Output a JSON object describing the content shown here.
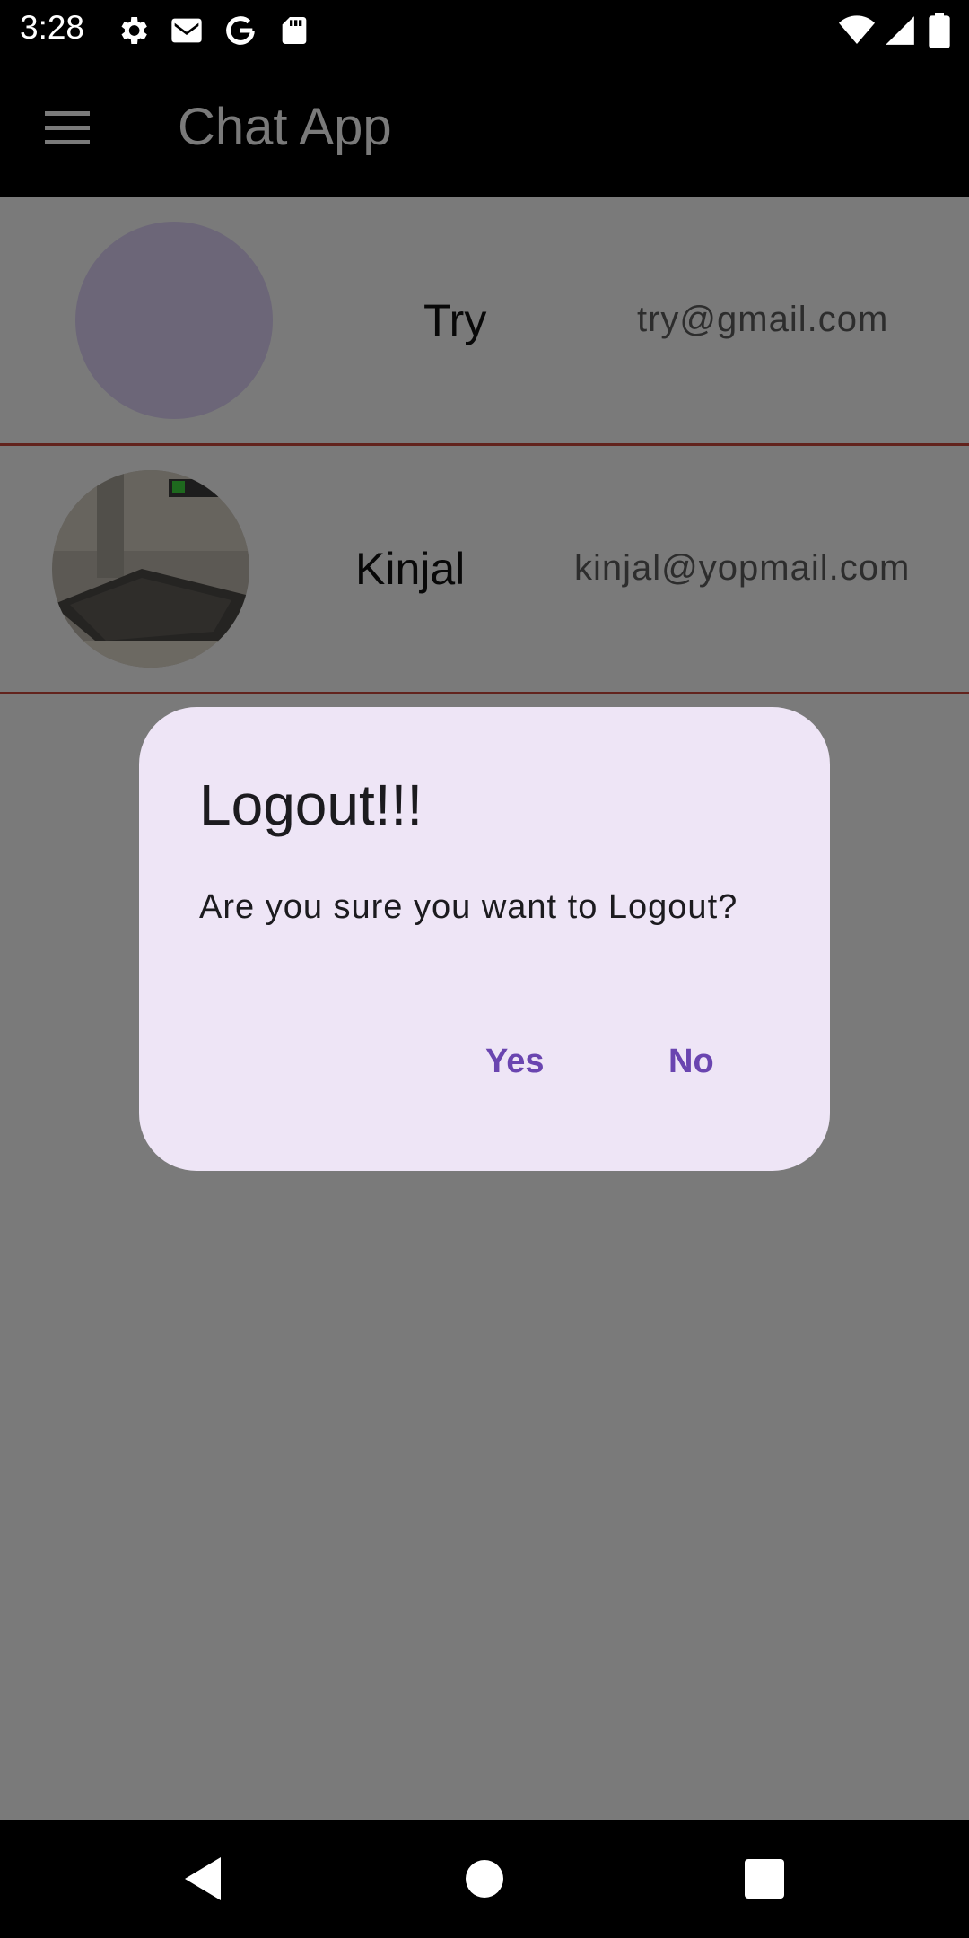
{
  "status_bar": {
    "time": "3:28",
    "icons": [
      "settings-icon",
      "gmail-icon",
      "google-icon",
      "sd-card-icon",
      "wifi-icon",
      "signal-icon",
      "battery-icon"
    ]
  },
  "app_bar": {
    "title": "Chat App",
    "menu_icon": "menu-icon"
  },
  "users": [
    {
      "name": "Try",
      "email": "try@gmail.com",
      "avatar": "placeholder-lavender"
    },
    {
      "name": "Kinjal",
      "email": "kinjal@yopmail.com",
      "avatar": "room-photo"
    }
  ],
  "dialog": {
    "title": "Logout!!!",
    "message": "Are you sure you want to Logout?",
    "yes_label": "Yes",
    "no_label": "No"
  },
  "nav_bar": {
    "icons": [
      "back-icon",
      "home-icon",
      "recents-icon"
    ]
  },
  "colors": {
    "accent": "#6a45b0",
    "dialog_bg": "#eee5f6",
    "divider": "#c5463a",
    "scrim": "rgba(0,0,0,0.5)"
  }
}
